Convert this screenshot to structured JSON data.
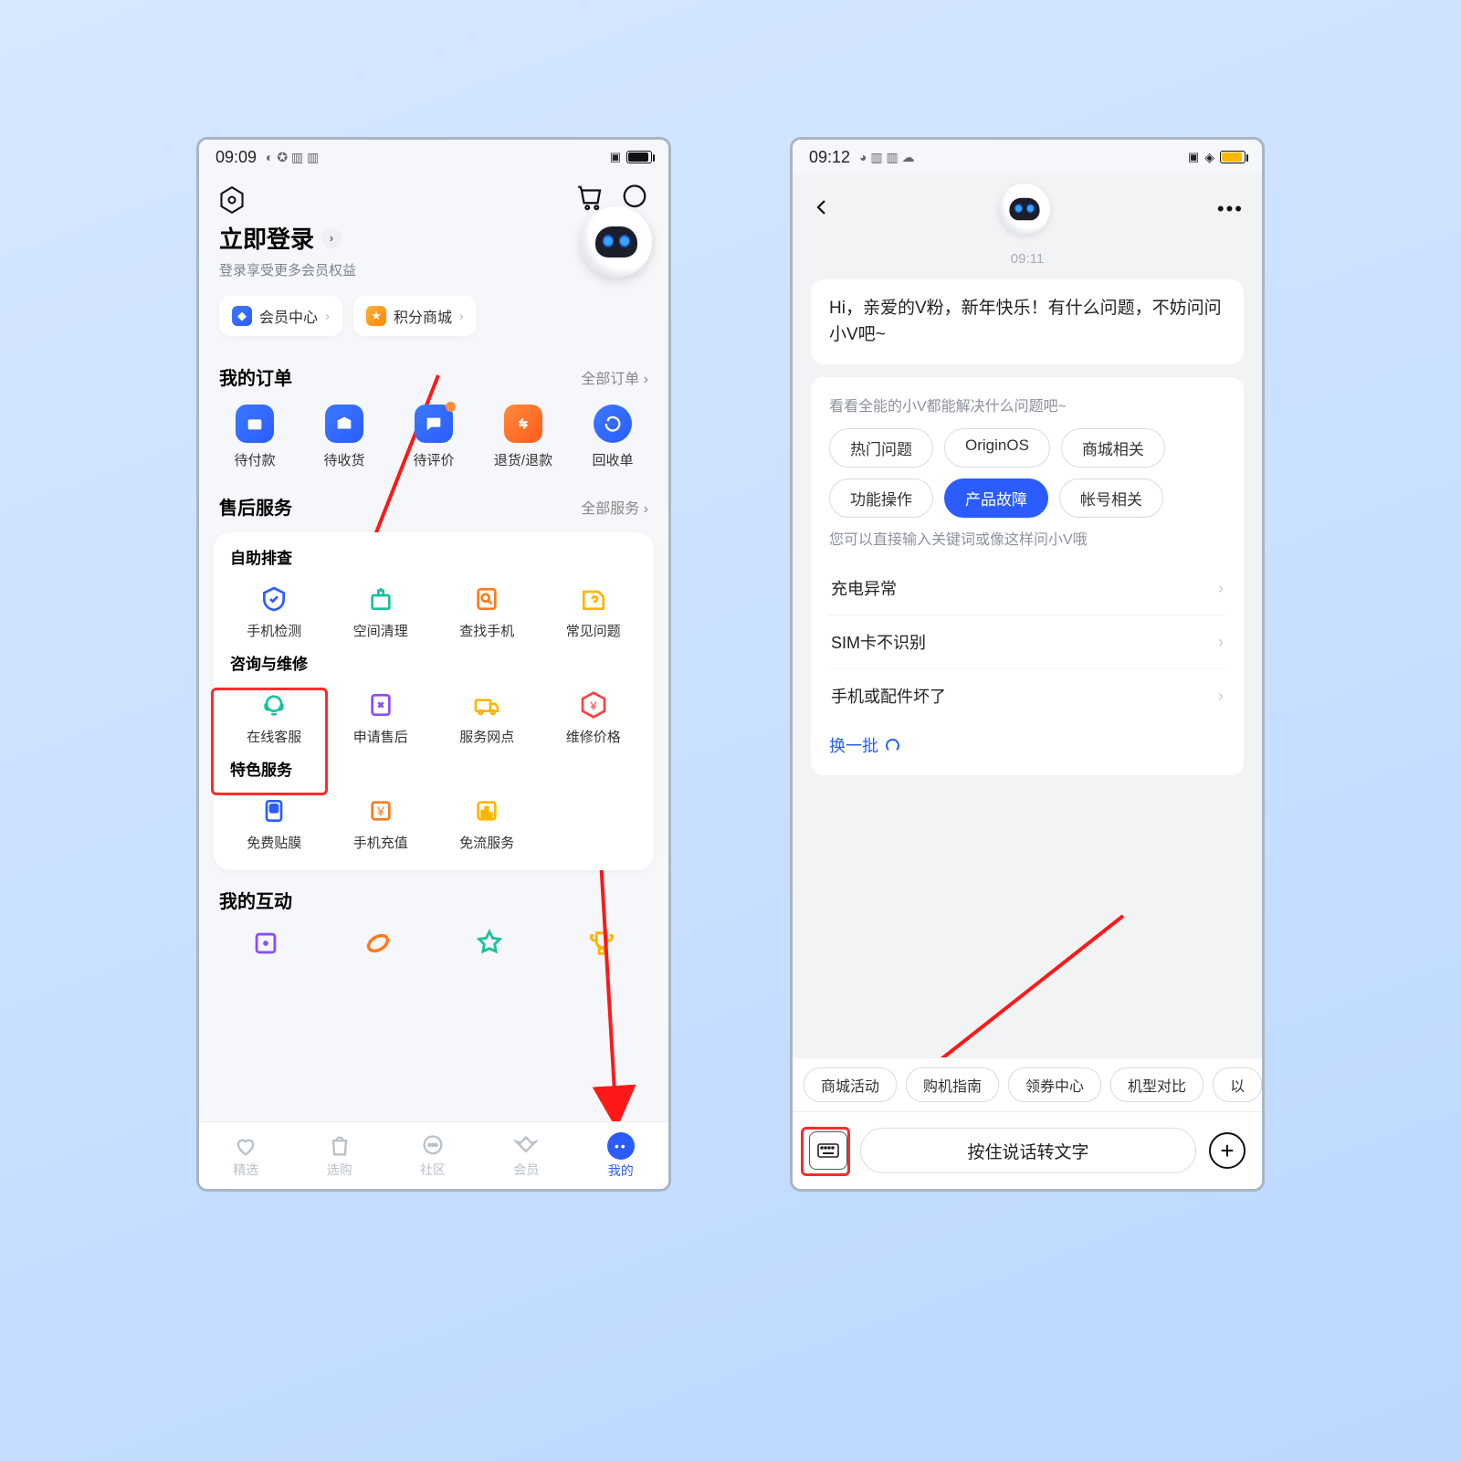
{
  "left": {
    "status": {
      "time": "09:09"
    },
    "login": {
      "title": "立即登录",
      "sub": "登录享受更多会员权益"
    },
    "chips": {
      "member": "会员中心",
      "points": "积分商城"
    },
    "orders": {
      "title": "我的订单",
      "more": "全部订单",
      "items": [
        "待付款",
        "待收货",
        "待评价",
        "退货/退款",
        "回收单"
      ]
    },
    "service": {
      "title": "售后服务",
      "more": "全部服务",
      "g1_title": "自助排查",
      "g1": [
        "手机检测",
        "空间清理",
        "查找手机",
        "常见问题"
      ],
      "g2_title": "咨询与维修",
      "g2": [
        "在线客服",
        "申请售后",
        "服务网点",
        "维修价格"
      ],
      "g3_title": "特色服务",
      "g3": [
        "免费贴膜",
        "手机充值",
        "免流服务"
      ]
    },
    "interact_title": "我的互动",
    "tabs": [
      "精选",
      "选购",
      "社区",
      "会员",
      "我的"
    ]
  },
  "right": {
    "status": {
      "time": "09:12"
    },
    "chat_time": "09:11",
    "greeting": "Hi，亲爱的V粉，新年快乐！有什么问题，不妨问问小V吧~",
    "panel_sub1": "看看全能的小V都能解决什么问题吧~",
    "pills": [
      "热门问题",
      "OriginOS",
      "商城相关",
      "功能操作",
      "产品故障",
      "帐号相关"
    ],
    "pill_active_index": 4,
    "panel_sub2": "您可以直接输入关键词或像这样问小V哦",
    "faq": [
      "充电异常",
      "SIM卡不识别",
      "手机或配件坏了"
    ],
    "refresh": "换一批",
    "suggestions": [
      "商城活动",
      "购机指南",
      "领券中心",
      "机型对比",
      "以"
    ],
    "speak_placeholder": "按住说话转文字"
  }
}
